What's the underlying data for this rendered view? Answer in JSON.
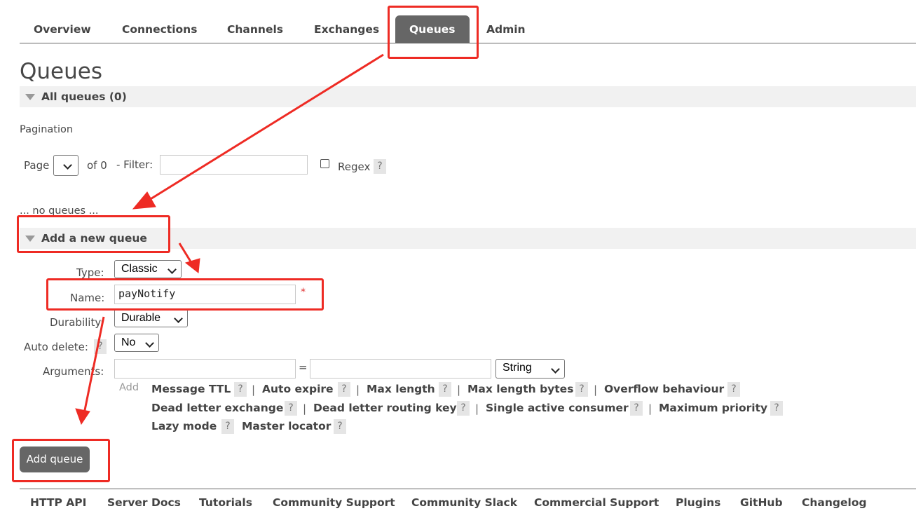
{
  "nav": {
    "tabs": [
      {
        "label": "Overview"
      },
      {
        "label": "Connections"
      },
      {
        "label": "Channels"
      },
      {
        "label": "Exchanges"
      },
      {
        "label": "Queues",
        "active": true
      },
      {
        "label": "Admin"
      }
    ]
  },
  "page_title": "Queues",
  "all_queues": {
    "title": "All queues (0)"
  },
  "pagination": {
    "heading": "Pagination",
    "page_label": "Page",
    "page_value": "",
    "of_label": "of 0",
    "filter_label": "- Filter:",
    "filter_value": "",
    "regex_label": "Regex",
    "regex_checked": false,
    "help": "?"
  },
  "no_queues": "... no queues ...",
  "add_queue_section": {
    "title": "Add a new queue",
    "type_label": "Type:",
    "type_value": "Classic",
    "name_label": "Name:",
    "name_value": "payNotify",
    "required_mark": "*",
    "durability_label": "Durability:",
    "durability_value": "Durable",
    "auto_delete_label": "Auto delete:",
    "auto_delete_value": "No",
    "arguments_label": "Arguments:",
    "arg_key_value": "",
    "arg_equals": "=",
    "arg_value": "",
    "arg_type_value": "String",
    "add_label": "Add",
    "help": "?",
    "separator": "|",
    "arg_links": [
      "Message TTL",
      "Auto expire",
      "Max length",
      "Max length bytes",
      "Overflow behaviour",
      "Dead letter exchange",
      "Dead letter routing key",
      "Single active consumer",
      "Maximum priority",
      "Lazy mode",
      "Master locator"
    ],
    "submit_label": "Add queue"
  },
  "footer": {
    "links": [
      "HTTP API",
      "Server Docs",
      "Tutorials",
      "Community Support",
      "Community Slack",
      "Commercial Support",
      "Plugins",
      "GitHub",
      "Changelog"
    ]
  },
  "annotation_color": "#ee2b24",
  "accent_color": "#666666"
}
